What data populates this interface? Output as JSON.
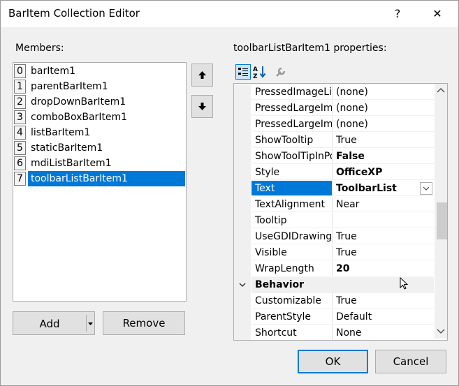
{
  "window": {
    "title": "BarItem Collection Editor",
    "help_label": "?",
    "close_label": "✕"
  },
  "members": {
    "label": "Members:",
    "items": [
      {
        "index": "0",
        "name": "barItem1"
      },
      {
        "index": "1",
        "name": "parentBarItem1"
      },
      {
        "index": "2",
        "name": "dropDownBarItem1"
      },
      {
        "index": "3",
        "name": "comboBoxBarItem1"
      },
      {
        "index": "4",
        "name": "listBarItem1"
      },
      {
        "index": "5",
        "name": "staticBarItem1"
      },
      {
        "index": "6",
        "name": "mdiListBarItem1"
      },
      {
        "index": "7",
        "name": "toolbarListBarItem1"
      }
    ],
    "selected_index": 7
  },
  "buttons": {
    "add": "Add",
    "remove": "Remove",
    "ok": "OK",
    "cancel": "Cancel",
    "move_up_icon": "arrow-up-icon",
    "move_down_icon": "arrow-down-icon"
  },
  "properties": {
    "label": "toolbarListBarItem1 properties:",
    "toolbar_icons": [
      "categorized-icon",
      "alphabetical-icon",
      "property-pages-icon"
    ],
    "rows": [
      {
        "name": "PressedImageList",
        "value": "(none)",
        "bold": false
      },
      {
        "name": "PressedLargeImageList",
        "value": "(none)",
        "bold": false
      },
      {
        "name": "PressedLargeImages",
        "value": "(none)",
        "bold": false
      },
      {
        "name": "ShowTooltip",
        "value": "True",
        "bold": false
      },
      {
        "name": "ShowToolTipInPopup",
        "value": "False",
        "bold": true
      },
      {
        "name": "Style",
        "value": "OfficeXP",
        "bold": true
      },
      {
        "name": "Text",
        "value": "ToolbarList",
        "bold": true,
        "selected": true
      },
      {
        "name": "TextAlignment",
        "value": "Near",
        "bold": false
      },
      {
        "name": "Tooltip",
        "value": "",
        "bold": false
      },
      {
        "name": "UseGDIDrawing",
        "value": "True",
        "bold": false
      },
      {
        "name": "Visible",
        "value": "True",
        "bold": false
      },
      {
        "name": "WrapLength",
        "value": "20",
        "bold": true
      }
    ],
    "category": "Behavior",
    "rows2": [
      {
        "name": "Customizable",
        "value": "True",
        "bold": false
      },
      {
        "name": "ParentStyle",
        "value": "Default",
        "bold": false
      },
      {
        "name": "Shortcut",
        "value": "None",
        "bold": false
      }
    ]
  },
  "colors": {
    "selection": "#0078d7",
    "button_face": "#e1e1e1"
  }
}
